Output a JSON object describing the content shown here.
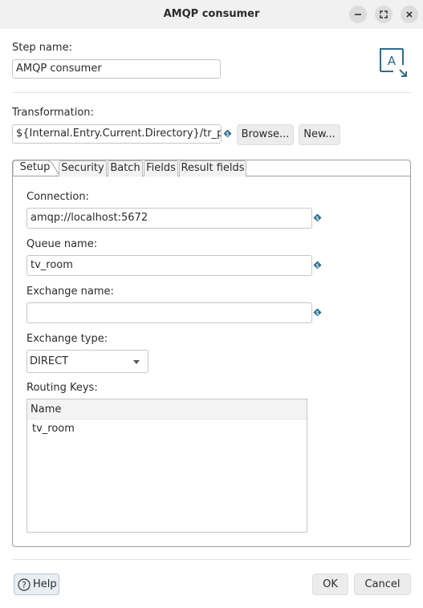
{
  "window": {
    "title": "AMQP consumer"
  },
  "step": {
    "label": "Step name:",
    "value": "AMQP consumer"
  },
  "transformation": {
    "label": "Transformation:",
    "value": "${Internal.Entry.Current.Directory}/tr_pro",
    "browse_label": "Browse...",
    "new_label": "New..."
  },
  "tabs": [
    "Setup",
    "Security",
    "Batch",
    "Fields",
    "Result fields"
  ],
  "setup": {
    "connection_label": "Connection:",
    "connection_value": "amqp://localhost:5672",
    "queue_label": "Queue name:",
    "queue_value": "tv_room",
    "exchange_label": "Exchange name:",
    "exchange_value": "",
    "exchange_type_label": "Exchange type:",
    "exchange_type_value": "DIRECT",
    "routing_label": "Routing Keys:",
    "routing_header": "Name",
    "routing_rows": [
      "tv_room"
    ]
  },
  "footer": {
    "help_label": "Help",
    "ok_label": "OK",
    "cancel_label": "Cancel"
  }
}
